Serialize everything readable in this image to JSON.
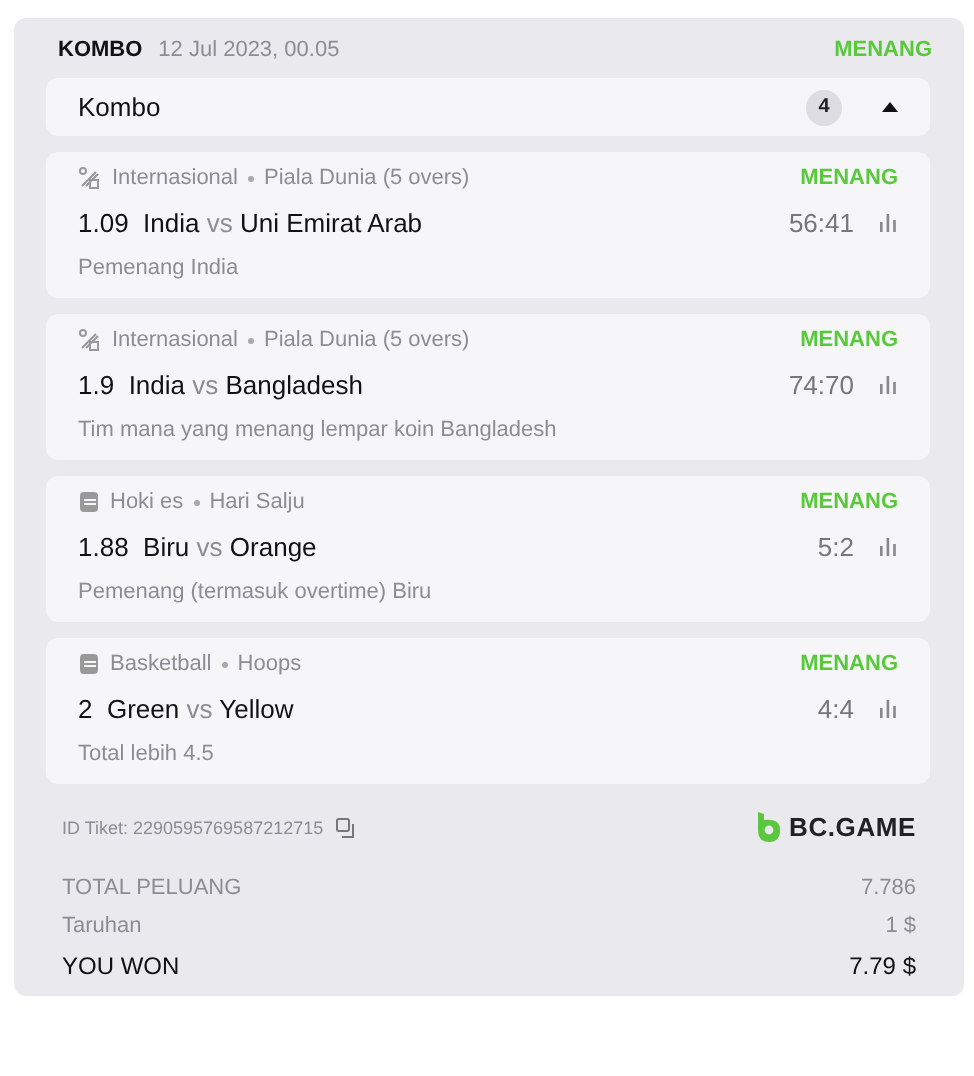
{
  "header": {
    "type": "KOMBO",
    "date": "12 Jul 2023, 00.05",
    "status": "MENANG"
  },
  "combo": {
    "title": "Kombo",
    "count": "4",
    "expanded": true
  },
  "bets": [
    {
      "kind": "cricket",
      "league": "Internasional",
      "tournament": "Piala Dunia (5 overs)",
      "status": "MENANG",
      "odds": "1.09",
      "home": "India",
      "vs": "vs",
      "away": "Uni Emirat Arab",
      "score": "56:41",
      "market": "Pemenang India"
    },
    {
      "kind": "cricket",
      "league": "Internasional",
      "tournament": "Piala Dunia (5 overs)",
      "status": "MENANG",
      "odds": "1.9",
      "home": "India",
      "vs": "vs",
      "away": "Bangladesh",
      "score": "74:70",
      "market": "Tim mana yang menang lempar koin Bangladesh"
    },
    {
      "kind": "hockey",
      "league": "Hoki es",
      "tournament": "Hari Salju",
      "status": "MENANG",
      "odds": "1.88",
      "home": "Biru",
      "vs": "vs",
      "away": "Orange",
      "score": "5:2",
      "market": "Pemenang (termasuk overtime) Biru"
    },
    {
      "kind": "hockey",
      "league": "Basketball",
      "tournament": "Hoops",
      "status": "MENANG",
      "odds": "2",
      "home": "Green",
      "vs": "vs",
      "away": "Yellow",
      "score": "4:4",
      "market": "Total lebih 4.5"
    }
  ],
  "ticket": {
    "label": "ID Tiket: 2290595769587212715",
    "brand": "BC.GAME"
  },
  "summary": [
    {
      "kind": "muted",
      "label": "TOTAL PELUANG",
      "value": "7.786"
    },
    {
      "kind": "muted",
      "label": "Taruhan",
      "value": "1 $"
    },
    {
      "kind": "total",
      "label": "YOU WON",
      "value": "7.79 $"
    }
  ]
}
